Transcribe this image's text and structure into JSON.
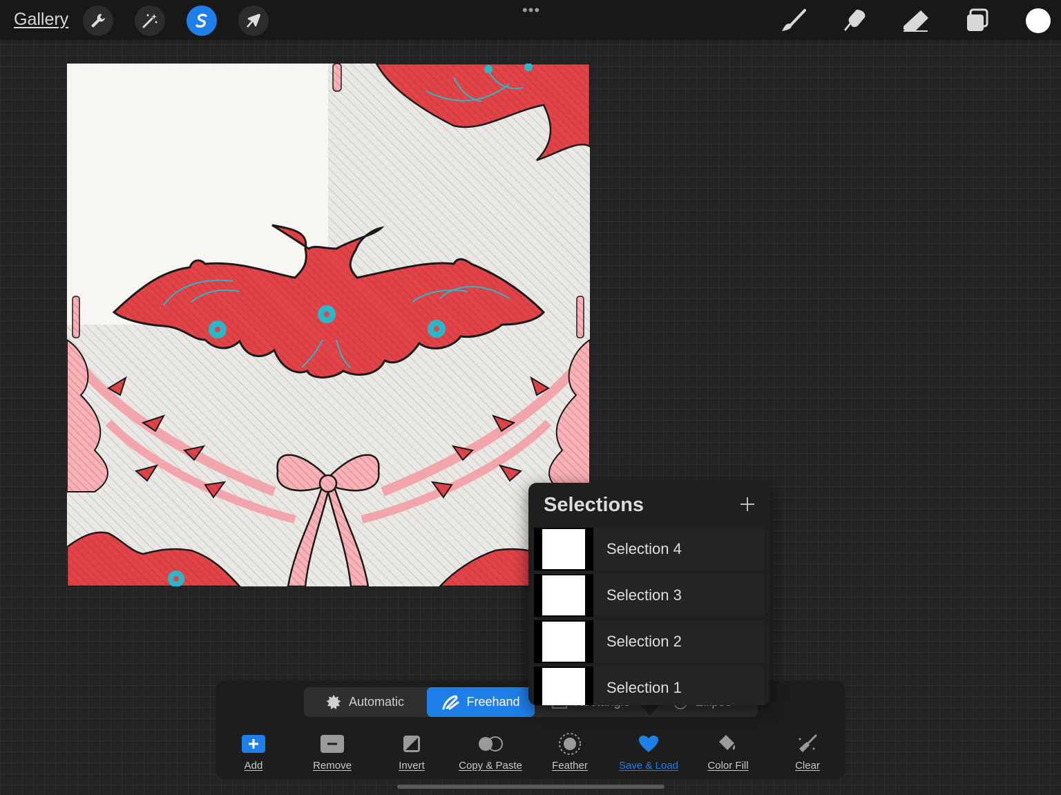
{
  "topbar": {
    "gallery_label": "Gallery",
    "tools": [
      "wrench-icon",
      "magic-wand-icon",
      "selection-icon",
      "transform-arrow-icon"
    ],
    "active_tool": "selection-icon",
    "more_label": "•••",
    "right_tools": [
      "brush-icon",
      "smudge-icon",
      "eraser-icon",
      "layers-icon"
    ],
    "current_color": "#ffffff"
  },
  "selection_modes": {
    "items": [
      "Automatic",
      "Freehand",
      "Rectangle",
      "Ellipse"
    ],
    "active": "Freehand"
  },
  "actions": {
    "items": [
      "Add",
      "Remove",
      "Invert",
      "Copy & Paste",
      "Feather",
      "Save & Load",
      "Color Fill",
      "Clear"
    ],
    "active": "Save & Load"
  },
  "selections_popover": {
    "title": "Selections",
    "items": [
      "Selection 4",
      "Selection 3",
      "Selection 2",
      "Selection 1"
    ]
  },
  "colors": {
    "accent": "#1f7fe8",
    "bat_red": "#e04448",
    "teal": "#2ab8c8",
    "pink": "#f2a6ab"
  }
}
